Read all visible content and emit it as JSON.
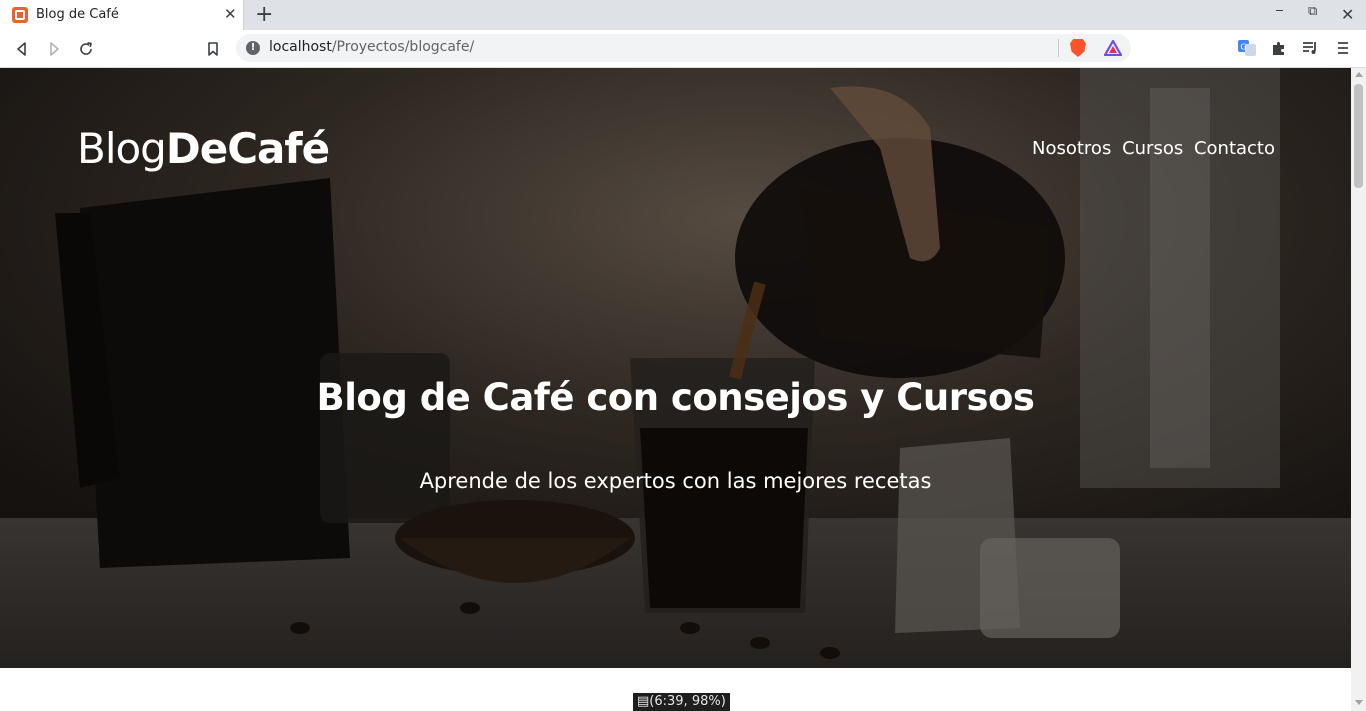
{
  "browser": {
    "tab_title": "Blog de Café",
    "new_tab_label": "+",
    "url_host": "localhost",
    "url_path": "/Proyectos/blogcafe/"
  },
  "site": {
    "logo_light": "Blog",
    "logo_bold": "DeCafé",
    "nav": [
      "Nosotros",
      "Cursos",
      "Contacto"
    ],
    "hero_title": "Blog de Café con consejos y Cursos",
    "hero_subtitle": "Aprende de los expertos con las mejores recetas"
  },
  "status_overlay": "(6:39, 98%)",
  "icons": {
    "favicon": "xampp-favicon",
    "back": "back-arrow-icon",
    "forward": "forward-arrow-icon",
    "reload": "reload-icon",
    "bookmark": "bookmark-icon",
    "info": "site-info-icon",
    "brave_shields": "brave-shields-icon",
    "brave_rewards": "brave-rewards-icon",
    "translate": "translate-icon",
    "extensions": "puzzle-piece-icon",
    "media": "media-queue-icon",
    "menu": "hamburger-menu-icon"
  },
  "colors": {
    "tabstrip_bg": "#dee1e6",
    "favicon": "#e8642c",
    "brave_orange": "#fb542b"
  }
}
